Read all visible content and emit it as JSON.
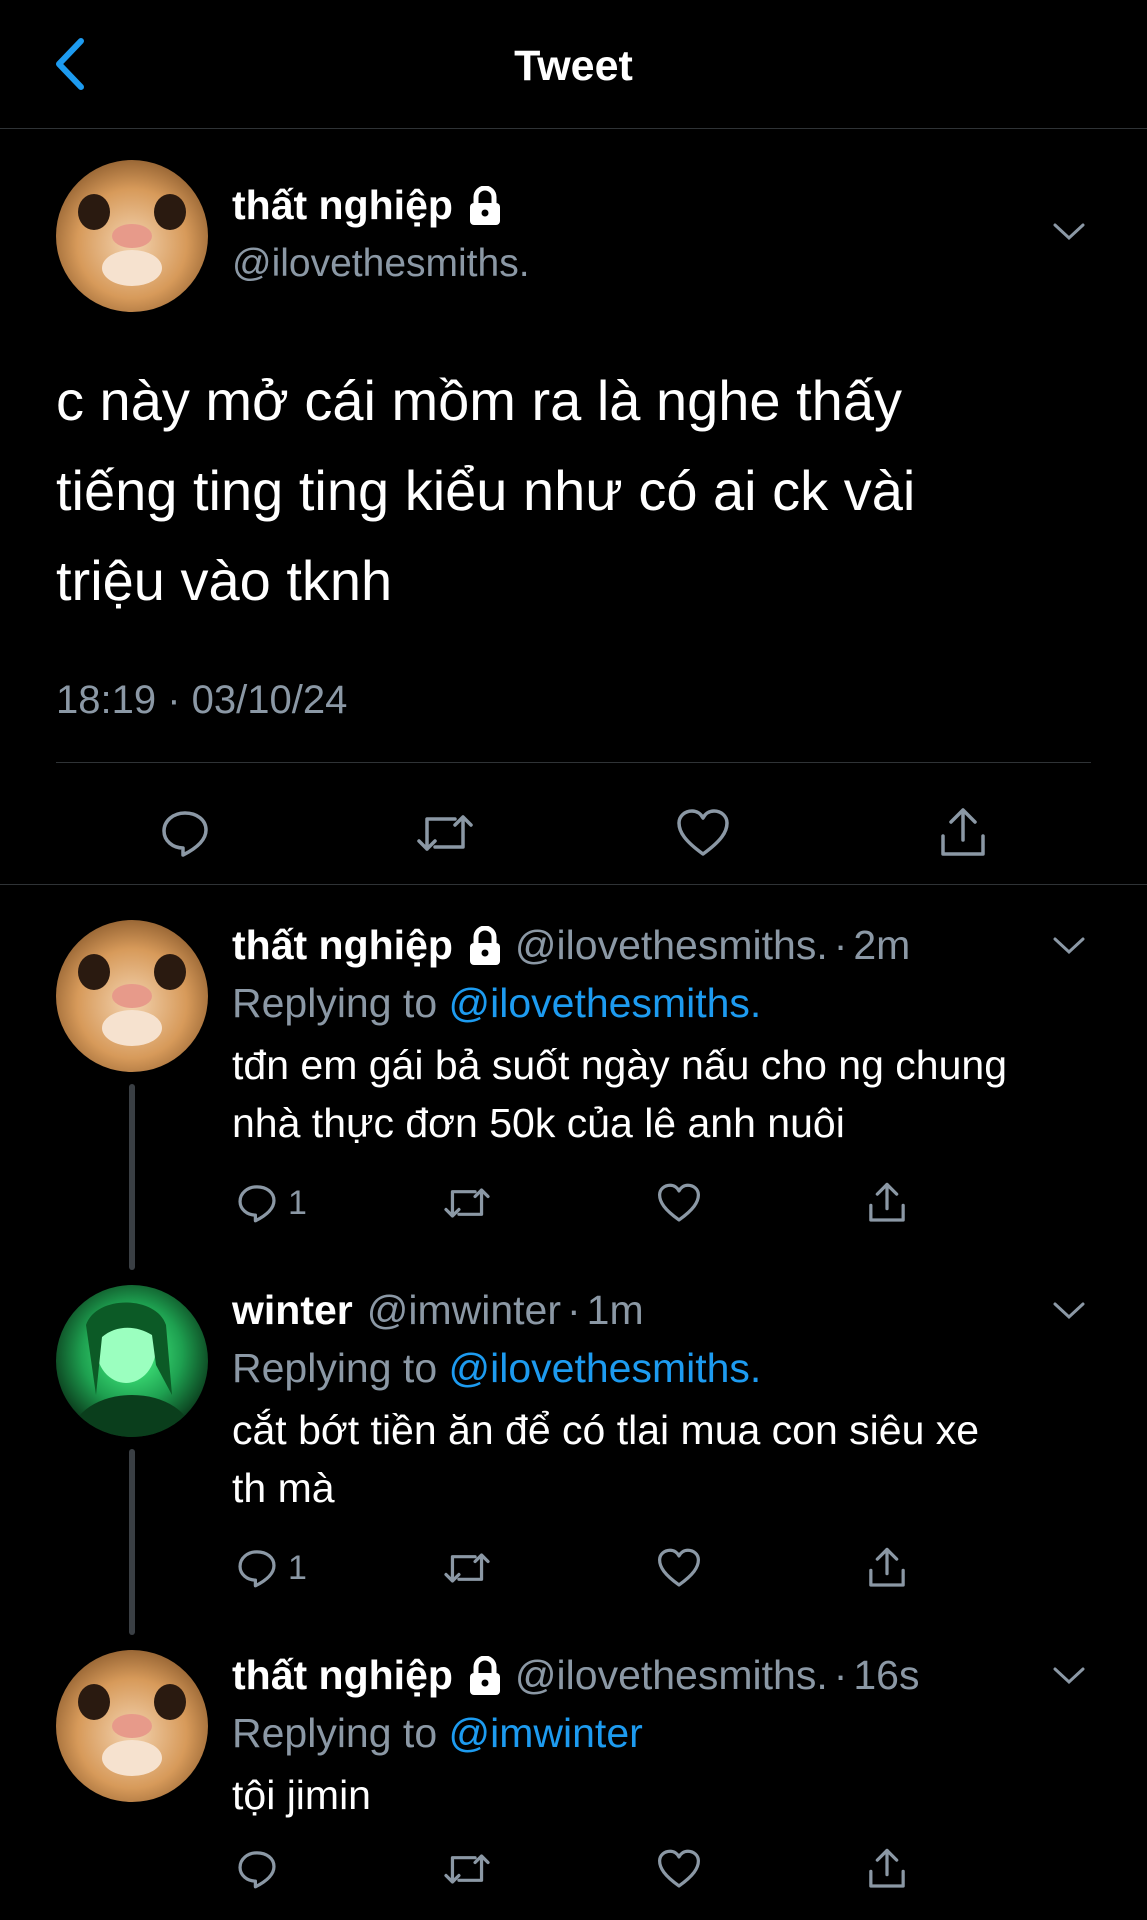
{
  "header": {
    "title": "Tweet"
  },
  "main_tweet": {
    "name": "thất nghiệp",
    "handle": "@ilovethesmiths.",
    "text_lines": [
      "c này mở cái mồm ra là nghe thấy",
      "tiếng ting ting kiểu như có ai ck vài",
      "triệu vào tknh"
    ],
    "timestamp": "18:19 · 03/10/24"
  },
  "replies": [
    {
      "name": "thất nghiệp",
      "handle": "@ilovethesmiths.",
      "time": "2m",
      "replying_label": "Replying to",
      "replying_to": "@ilovethesmiths.",
      "text_lines": [
        "tđn em gái bả suốt ngày nấu cho ng chung",
        "nhà thực đơn 50k của lê anh nuôi"
      ],
      "reply_count": "1"
    },
    {
      "name": "winter",
      "handle": "@imwinter",
      "time": "1m",
      "replying_label": "Replying to",
      "replying_to": "@ilovethesmiths.",
      "text_lines": [
        "cắt bớt tiền ăn để có tlai mua con siêu xe",
        "th mà"
      ],
      "reply_count": "1"
    },
    {
      "name": "thất nghiệp",
      "handle": "@ilovethesmiths.",
      "time": "16s",
      "replying_label": "Replying to",
      "replying_to": "@imwinter",
      "text_lines": [
        "tội jimin"
      ],
      "reply_count": ""
    }
  ],
  "colors": {
    "background": "#000000",
    "link": "#1d9bf0",
    "secondary": "#8b98a5",
    "icon": "#8b98a5"
  },
  "icons": [
    "chevron-left-icon",
    "lock-icon",
    "chevron-down-icon",
    "reply-icon",
    "retweet-icon",
    "like-icon",
    "share-icon"
  ]
}
